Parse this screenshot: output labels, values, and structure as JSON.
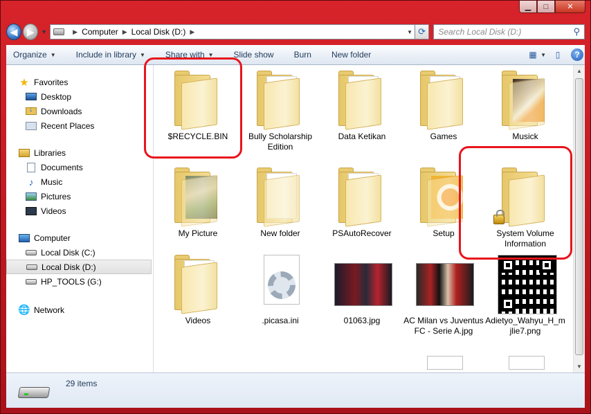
{
  "window": {
    "caption": {
      "minimize": "▁",
      "maximize": "□",
      "close": "✕"
    }
  },
  "address": {
    "crumbs": [
      "Computer",
      "Local Disk (D:)"
    ],
    "search_placeholder": "Search Local Disk (D:)"
  },
  "toolbar": {
    "items": [
      "Organize",
      "Include in library",
      "Share with",
      "Slide show",
      "Burn",
      "New folder"
    ]
  },
  "nav": {
    "favorites": {
      "title": "Favorites",
      "items": [
        "Desktop",
        "Downloads",
        "Recent Places"
      ]
    },
    "libraries": {
      "title": "Libraries",
      "items": [
        "Documents",
        "Music",
        "Pictures",
        "Videos"
      ]
    },
    "computer": {
      "title": "Computer",
      "items": [
        "Local Disk (C:)",
        "Local Disk (D:)",
        "HP_TOOLS (G:)"
      ]
    },
    "network": {
      "title": "Network"
    }
  },
  "files": [
    {
      "name": "$RECYCLE.BIN"
    },
    {
      "name": "Bully Scholarship Edition"
    },
    {
      "name": "Data Ketikan"
    },
    {
      "name": "Games"
    },
    {
      "name": "Musick"
    },
    {
      "name": "My Picture"
    },
    {
      "name": "New folder"
    },
    {
      "name": "PSAutoRecover"
    },
    {
      "name": "Setup"
    },
    {
      "name": "System Volume Information"
    },
    {
      "name": "Videos"
    },
    {
      "name": ".picasa.ini"
    },
    {
      "name": "01063.jpg"
    },
    {
      "name": "AC Milan vs Juventus FC - Serie A.jpg"
    },
    {
      "name": "Adietyo_Wahyu_H_mjlie7.png"
    }
  ],
  "status": {
    "item_count": "29 items"
  },
  "colors": {
    "title_bar": "#c8141c",
    "highlight": "#e8141c",
    "folder": "#f4dd92",
    "link_text": "#1e395b"
  }
}
